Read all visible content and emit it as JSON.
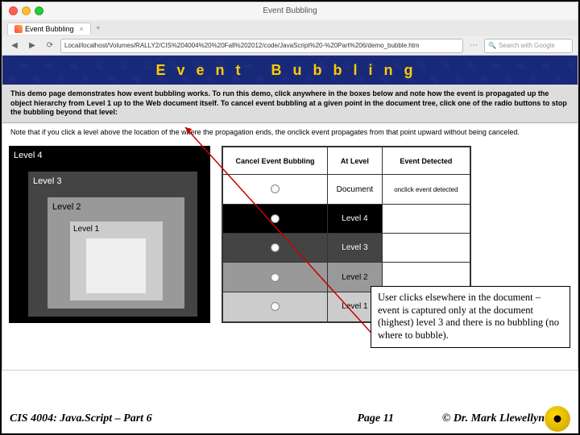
{
  "window": {
    "title": "Event Bubbling"
  },
  "tab": {
    "label": "Event Bubbling"
  },
  "url": "Local/localhost/Volumes/RALLY2/CIS%204004%20%20Fall%202012/code/JavaScript%20-%20Part%206/demo_bubble.htm",
  "search": {
    "placeholder": "Search with Google"
  },
  "banner": {
    "word1": "Event",
    "word2": "Bubbling"
  },
  "intro": {
    "p1": "This demo page demonstrates how event bubbling works. To run this demo, click anywhere in the boxes below and note how the event is propagated up the object hierarchy from Level 1 up to the Web document itself. To cancel event bubbling at a given point in the document tree, click one of the radio buttons to stop the bubbling beyond that level:",
    "p2": "Note that if you click a level above the location of the where the propagation ends, the onclick event propagates from that point upward without being canceled."
  },
  "levels": {
    "l4": "Level 4",
    "l3": "Level 3",
    "l2": "Level 2",
    "l1": "Level 1"
  },
  "table": {
    "h1": "Cancel Event Bubbling",
    "h2": "At Level",
    "h3": "Event Detected",
    "rows": {
      "doc": "Document",
      "l4": "Level 4",
      "l3": "Level 3",
      "l2": "Level 2",
      "l1": "Level 1"
    },
    "detected": "onclick event detected"
  },
  "annotation": "User clicks elsewhere in the document – event is captured only at the document (highest) level 3 and there is no bubbling (no where to bubble).",
  "footer": {
    "course": "CIS 4004: Java.Script – Part 6",
    "page": "Page 11",
    "author": "© Dr. Mark Llewellyn"
  }
}
